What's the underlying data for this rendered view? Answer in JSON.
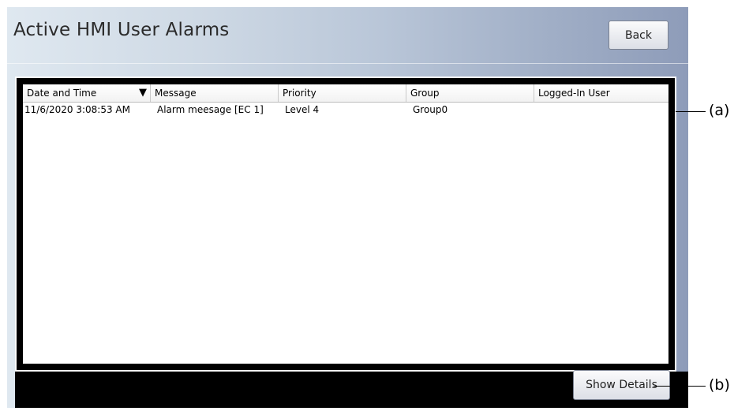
{
  "window": {
    "title": "Active HMI User Alarms"
  },
  "header": {
    "back_label": "Back"
  },
  "table": {
    "columns": [
      "Date and Time",
      "Message",
      "Priority",
      "Group",
      "Logged-In User"
    ],
    "sort_indicator": "▼",
    "rows": [
      {
        "date_time": "11/6/2020 3:08:53 AM",
        "message": "Alarm meesage [EC 1]",
        "priority": "Level 4",
        "group": "Group0",
        "user": ""
      }
    ]
  },
  "footer": {
    "details_label": "Show Details"
  },
  "callouts": {
    "a": "(a)",
    "b": "(b)"
  }
}
